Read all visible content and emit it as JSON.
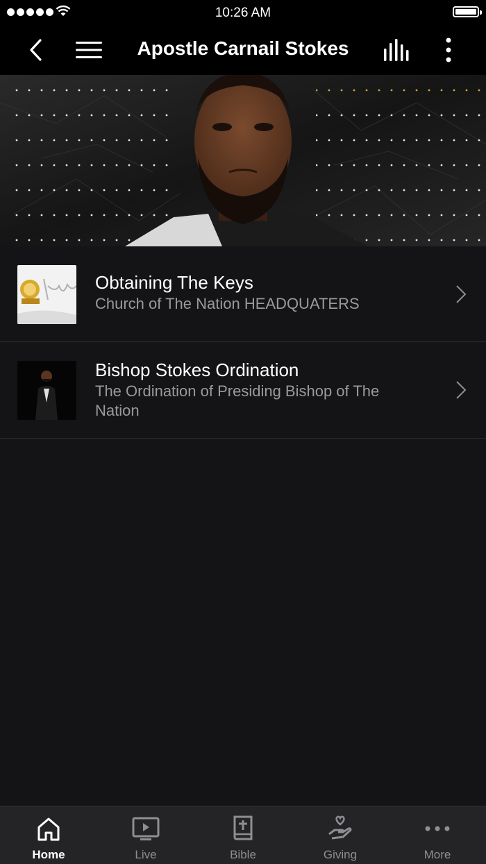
{
  "status_bar": {
    "time": "10:26 AM"
  },
  "navbar": {
    "title": "Apostle Carnail Stokes"
  },
  "list": [
    {
      "title": "Obtaining The Keys",
      "subtitle": "Church of The Nation HEADQUATERS"
    },
    {
      "title": "Bishop Stokes Ordination",
      "subtitle": "The Ordination of Presiding Bishop of The Nation"
    }
  ],
  "tabs": [
    {
      "label": "Home",
      "icon": "home-icon",
      "active": true
    },
    {
      "label": "Live",
      "icon": "tv-play-icon"
    },
    {
      "label": "Bible",
      "icon": "bible-icon"
    },
    {
      "label": "Giving",
      "icon": "giving-hand-icon"
    },
    {
      "label": "More",
      "icon": "more-dots-icon"
    }
  ],
  "colors": {
    "background": "#141416",
    "bar": "#000000",
    "tabbar": "#242426",
    "accent_gold": "#d4a73a"
  }
}
